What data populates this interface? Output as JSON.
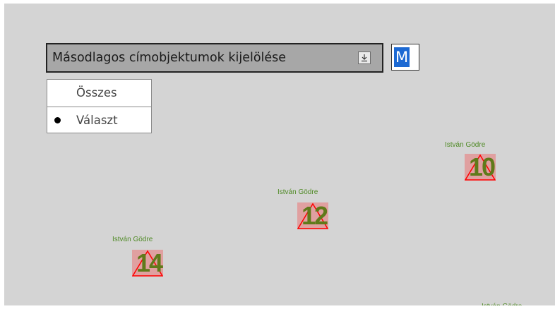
{
  "dropdown": {
    "label": "Másodlagos címobjektumok kijelölése"
  },
  "text_input": {
    "selected_text": "M"
  },
  "radio_group": {
    "options": [
      {
        "label": "Összes",
        "selected": false
      },
      {
        "label": "Választ",
        "selected": true
      }
    ]
  },
  "markers": [
    {
      "label": "István Gödre",
      "number": "10"
    },
    {
      "label": "István Gödre",
      "number": "12"
    },
    {
      "label": "István Gödre",
      "number": "14"
    }
  ],
  "colors": {
    "map_background": "#d4d4d4",
    "marker_label": "#4f8a25",
    "marker_number": "#607a1a",
    "marker_fill": "#e0a0a0",
    "marker_outline": "#ff0000",
    "selection": "#1c69d3"
  }
}
